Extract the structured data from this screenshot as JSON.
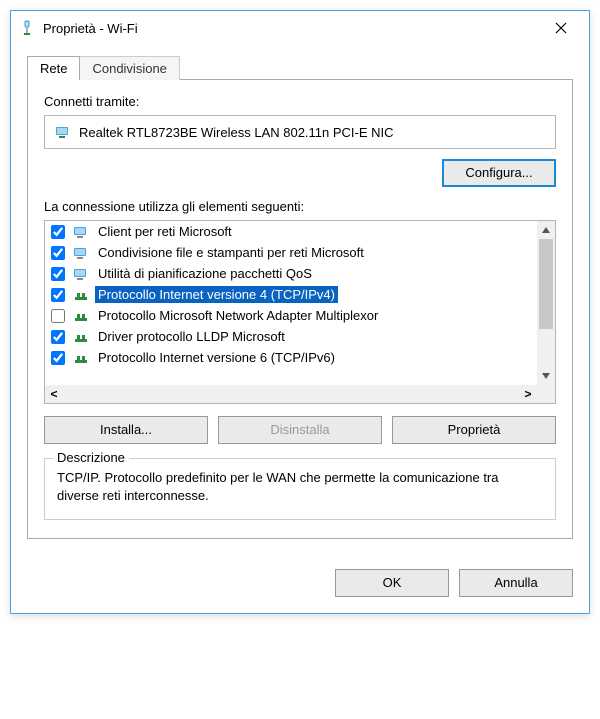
{
  "title": "Proprietà - Wi-Fi",
  "tabs": [
    {
      "label": "Rete"
    },
    {
      "label": "Condivisione"
    }
  ],
  "connect_label": "Connetti tramite:",
  "adapter_name": "Realtek RTL8723BE Wireless LAN 802.11n PCI-E NIC",
  "configure_btn": "Configura...",
  "items_label": "La connessione utilizza gli elementi seguenti:",
  "items": [
    {
      "checked": true,
      "label": "Client per reti Microsoft",
      "icon": "client"
    },
    {
      "checked": true,
      "label": "Condivisione file e stampanti per reti Microsoft",
      "icon": "client"
    },
    {
      "checked": true,
      "label": "Utilità di pianificazione pacchetti QoS",
      "icon": "client"
    },
    {
      "checked": true,
      "label": "Protocollo Internet versione 4 (TCP/IPv4)",
      "icon": "proto",
      "selected": true
    },
    {
      "checked": false,
      "label": "Protocollo Microsoft Network Adapter Multiplexor",
      "icon": "proto"
    },
    {
      "checked": true,
      "label": "Driver protocollo LLDP Microsoft",
      "icon": "proto"
    },
    {
      "checked": true,
      "label": "Protocollo Internet versione 6 (TCP/IPv6)",
      "icon": "proto"
    }
  ],
  "install_btn": "Installa...",
  "uninstall_btn": "Disinstalla",
  "properties_btn": "Proprietà",
  "description_title": "Descrizione",
  "description_text": "TCP/IP. Protocollo predefinito per le WAN che permette la comunicazione tra diverse reti interconnesse.",
  "ok_btn": "OK",
  "cancel_btn": "Annulla"
}
